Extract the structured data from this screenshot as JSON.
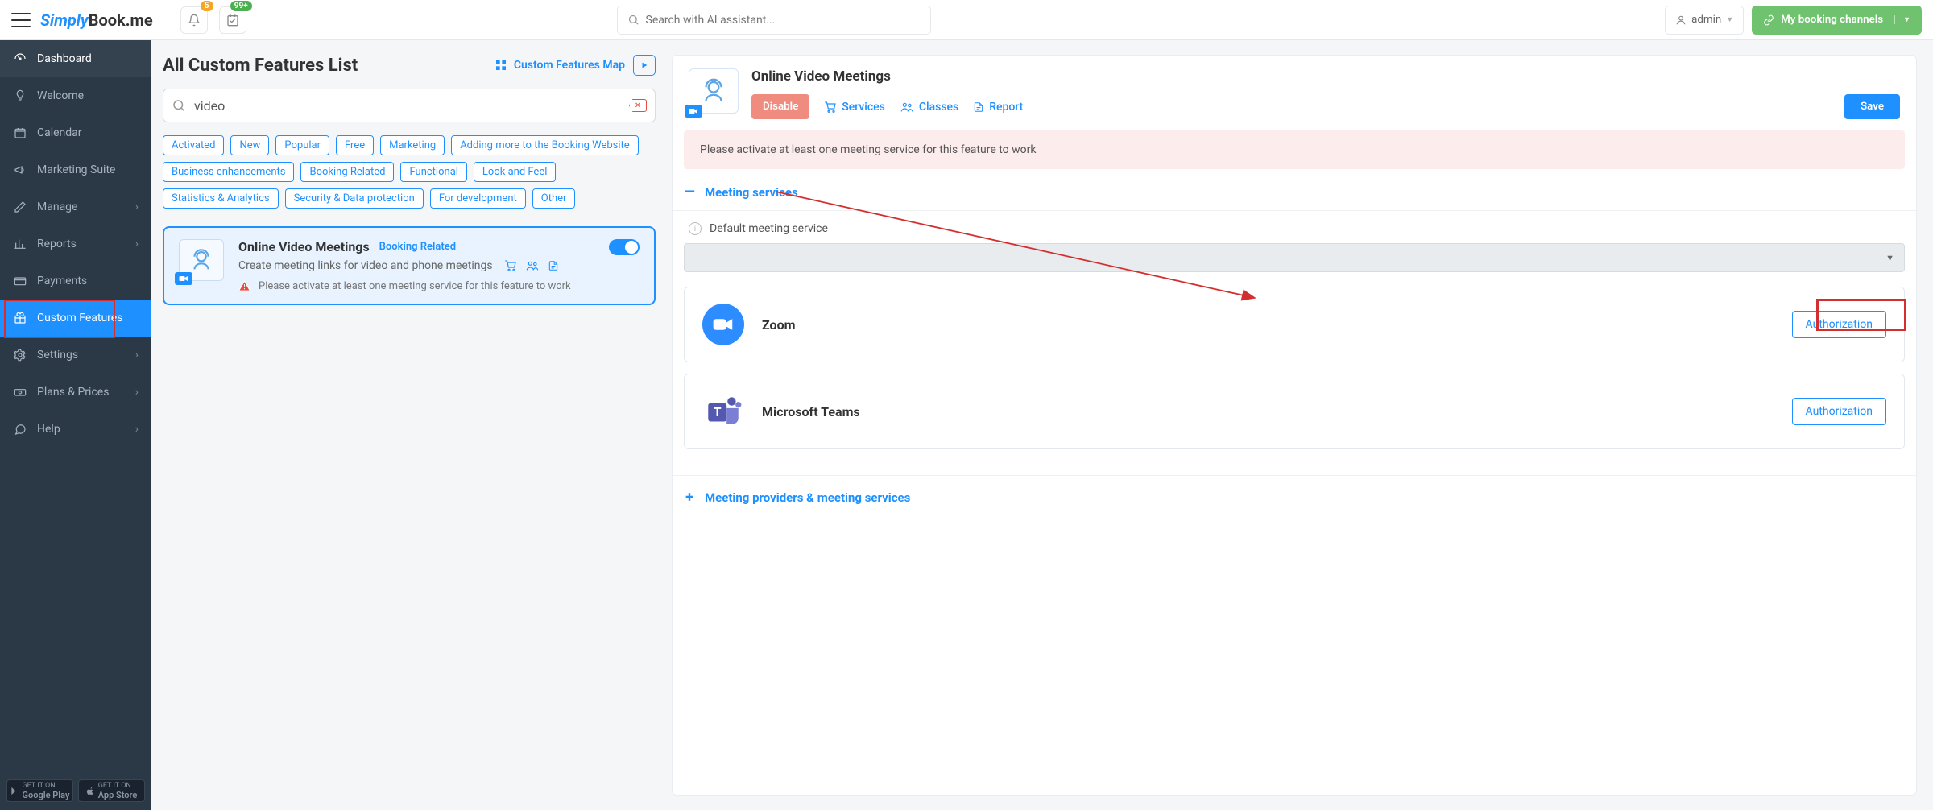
{
  "topbar": {
    "badge_bell": "5",
    "badge_cal": "99+",
    "search_placeholder": "Search with AI assistant...",
    "admin_label": "admin",
    "channels_label": "My booking channels"
  },
  "logo": {
    "part1": "Simply",
    "part2": "Book",
    "part3": ".me"
  },
  "sidebar": {
    "items": [
      {
        "label": "Dashboard"
      },
      {
        "label": "Welcome"
      },
      {
        "label": "Calendar"
      },
      {
        "label": "Marketing Suite"
      },
      {
        "label": "Manage"
      },
      {
        "label": "Reports"
      },
      {
        "label": "Payments"
      },
      {
        "label": "Custom Features"
      },
      {
        "label": "Settings"
      },
      {
        "label": "Plans & Prices"
      },
      {
        "label": "Help"
      }
    ],
    "store1_small": "GET IT ON",
    "store1_big": "Google Play",
    "store2_small": "GET IT ON",
    "store2_big": "App Store"
  },
  "page": {
    "title": "All Custom Features List",
    "map_label": "Custom Features Map",
    "search_value": "video"
  },
  "filters": [
    "Activated",
    "New",
    "Popular",
    "Free",
    "Marketing",
    "Adding more to the Booking Website",
    "Business enhancements",
    "Booking Related",
    "Functional",
    "Look and Feel",
    "Statistics & Analytics",
    "Security & Data protection",
    "For development",
    "Other"
  ],
  "feature": {
    "title": "Online Video Meetings",
    "category": "Booking Related",
    "desc": "Create meeting links for video and phone meetings",
    "warning": "Please activate at least one meeting service for this feature to work"
  },
  "panel": {
    "title": "Online Video Meetings",
    "disable": "Disable",
    "services": "Services",
    "classes": "Classes",
    "report": "Report",
    "save": "Save",
    "alert": "Please activate at least one meeting service for this feature to work",
    "section1": "Meeting services",
    "default_label": "Default meeting service",
    "provider1": "Zoom",
    "provider2": "Microsoft Teams",
    "auth": "Authorization",
    "section2": "Meeting providers & meeting services"
  }
}
